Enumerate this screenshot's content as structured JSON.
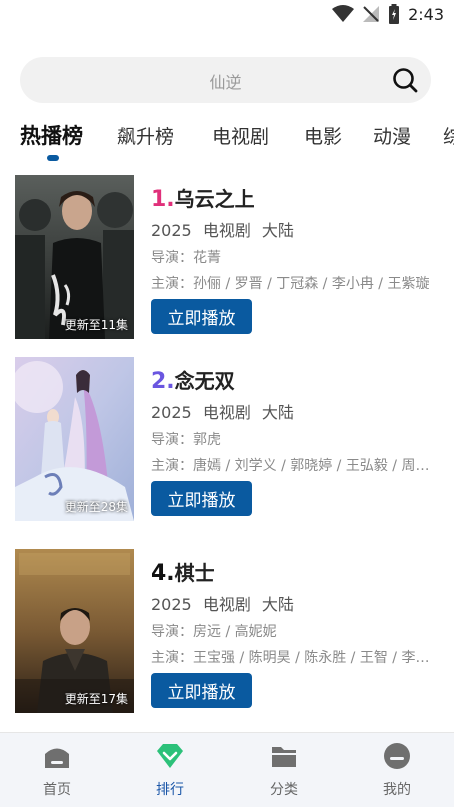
{
  "status_bar": {
    "time": "2:43"
  },
  "search": {
    "placeholder": "仙逆"
  },
  "tabs": [
    {
      "label": "热播榜",
      "active": true
    },
    {
      "label": "飙升榜"
    },
    {
      "label": "电视剧"
    },
    {
      "label": "电影"
    },
    {
      "label": "动漫"
    },
    {
      "label": "综"
    }
  ],
  "items": [
    {
      "rank": "1.",
      "rank_color": "#e0307a",
      "title": "乌云之上",
      "year": "2025",
      "type": "电视剧",
      "region": "大陆",
      "director": "导演：花菁",
      "cast": "主演：孙俪 / 罗晋 / 丁冠森 / 李小冉 / 王紫璇",
      "badge": "更新至11集",
      "play_label": "立即播放"
    },
    {
      "rank": "2.",
      "rank_color": "#6a56e0",
      "title": "念无双",
      "year": "2025",
      "type": "电视剧",
      "region": "大陆",
      "director": "导演：郭虎",
      "cast": "主演：唐嫣 / 刘学义 / 郭晓婷 / 王弘毅 / 周峻纬",
      "badge": "更新至28集",
      "play_label": "立即播放"
    },
    {
      "rank": "4.",
      "rank_color": "#111111",
      "title": "棋士",
      "year": "2025",
      "type": "电视剧",
      "region": "大陆",
      "director": "导演：房远 / 高妮妮",
      "cast": "主演：王宝强 / 陈明昊 / 陈永胜 / 王智 / 李乃文",
      "badge": "更新至17集",
      "play_label": "立即播放"
    }
  ],
  "bottom_nav": [
    {
      "label": "首页",
      "icon": "home-icon"
    },
    {
      "label": "排行",
      "icon": "ranking-icon",
      "active": true
    },
    {
      "label": "分类",
      "icon": "folder-icon"
    },
    {
      "label": "我的",
      "icon": "profile-icon"
    }
  ],
  "colors": {
    "accent": "#0a5aa0",
    "active_nav": "#1a56a8"
  }
}
